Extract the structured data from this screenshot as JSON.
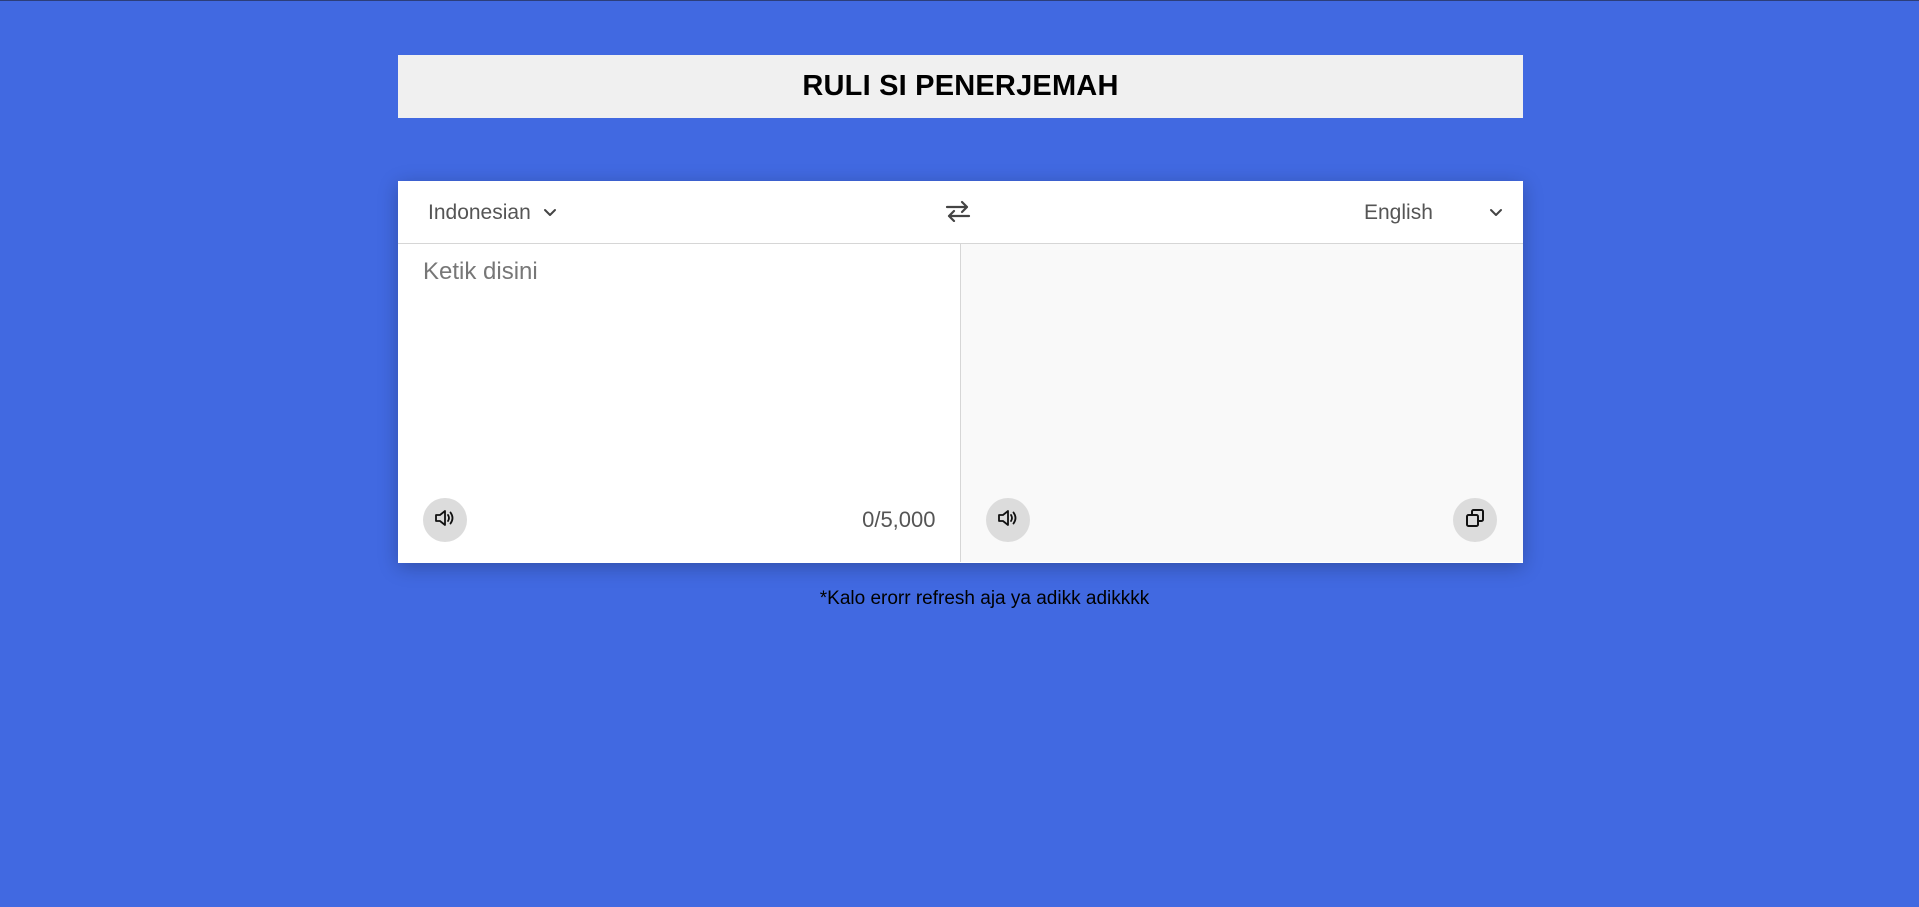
{
  "header": {
    "title": "RULI SI PENERJEMAH"
  },
  "controls": {
    "from_language": "Indonesian",
    "to_language": "English",
    "chevron_icon": "chevron-down-icon",
    "swap_icon": "swap-arrows-icon"
  },
  "source": {
    "placeholder": "Ketik disini",
    "value": "",
    "char_count": "0/5,000",
    "speak_icon": "speaker-icon"
  },
  "target": {
    "value": "",
    "speak_icon": "speaker-icon",
    "copy_icon": "copy-icon"
  },
  "footer": {
    "note": "*Kalo erorr refresh aja ya adikk adikkkk"
  },
  "colors": {
    "background": "#4169e1",
    "header_bg": "#f0f0f0",
    "panel_bg": "#ffffff",
    "output_bg": "#f9f9f9",
    "icon_button_bg": "#dcdcdc"
  }
}
